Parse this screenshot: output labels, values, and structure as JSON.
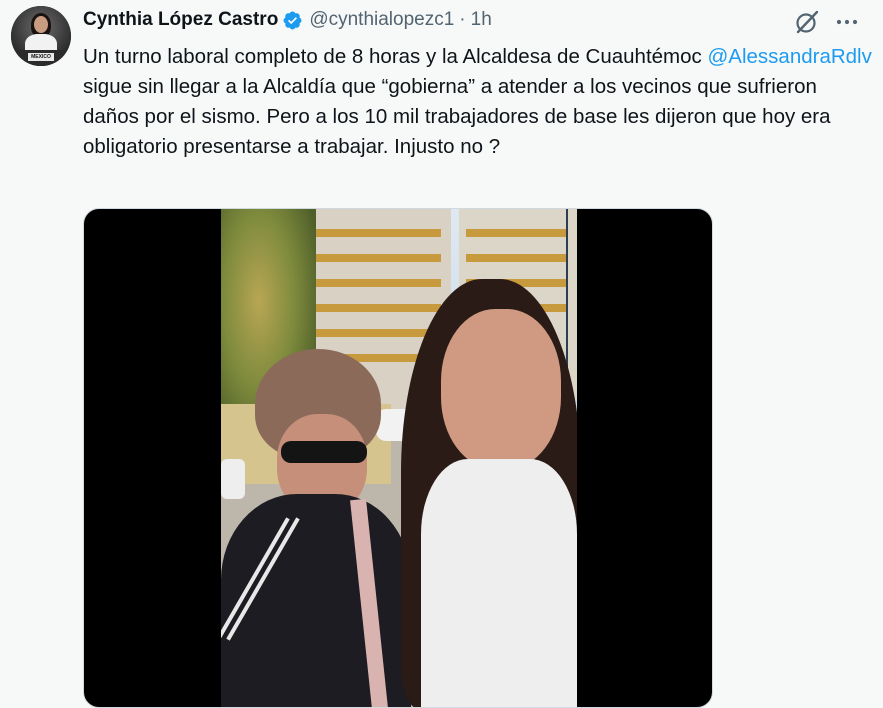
{
  "author": {
    "name": "Cynthia López Castro",
    "handle": "@cynthialopezc1",
    "separator": "·",
    "time": "1h",
    "avatar_sign_text": "MEXICO"
  },
  "tweet": {
    "text_before": "Un turno laboral completo de 8 horas y la Alcaldesa de Cuauhtémoc ",
    "mention": "@AlessandraRdlv",
    "text_after": " sigue sin llegar a la Alcaldía  que “gobierna” a atender a los vecinos que sufrieron daños por el sismo. Pero a los 10 mil trabajadores de base les dijeron que hoy era obligatorio presentarse a trabajar. Injusto no ?"
  },
  "icons": {
    "verified": "verified-badge-icon",
    "grok": "grok-icon",
    "more": "more-icon"
  },
  "colors": {
    "background": "#f7f9f9",
    "text": "#0f1419",
    "secondary": "#536471",
    "accent": "#1d9bf0"
  }
}
